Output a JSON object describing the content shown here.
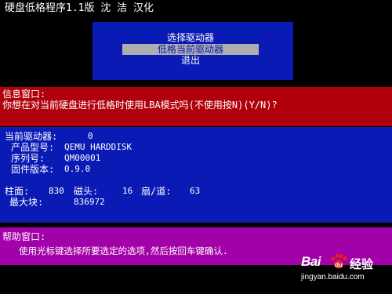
{
  "header": {
    "title": "硬盘低格程序1.1版 沈 洁 汉化"
  },
  "menu": {
    "items": [
      {
        "label": "选择驱动器",
        "selected": false
      },
      {
        "label": "低格当前驱动器",
        "selected": true
      },
      {
        "label": "退出",
        "selected": false
      }
    ]
  },
  "info": {
    "title": "信息窗口:",
    "message": "你想在对当前硬盘进行低格时使用LBA模式吗(不使用按N)(Y/N)?"
  },
  "drive": {
    "current_label": "当前驱动器:",
    "current_value": "0",
    "model_label": "产品型号:",
    "model_value": "QEMU HARDDISK",
    "serial_label": "序列号:",
    "serial_value": "QM00001",
    "firmware_label": "固件版本:",
    "firmware_value": "0.9.0",
    "cylinders_label": "柱面:",
    "cylinders_value": "830",
    "heads_label": "磁头:",
    "heads_value": "16",
    "sectors_label": "扇/道:",
    "sectors_value": "63",
    "maxblock_label": "最大块:",
    "maxblock_value": "836972"
  },
  "help": {
    "title": "帮助窗口:",
    "message": "使用光标键选择所要选定的选项,然后按回车键确认."
  },
  "watermark": {
    "brand": "Bai",
    "brand_suffix": "经验",
    "url": "jingyan.baidu.com",
    "paw_icon": "baidu-paw-icon"
  },
  "colors": {
    "menu_bg": "#0a1ab4",
    "info_bg": "#b0000c",
    "drive_bg": "#0a1ab4",
    "help_bg": "#a200a8",
    "selected_bg": "#aeaeae"
  }
}
